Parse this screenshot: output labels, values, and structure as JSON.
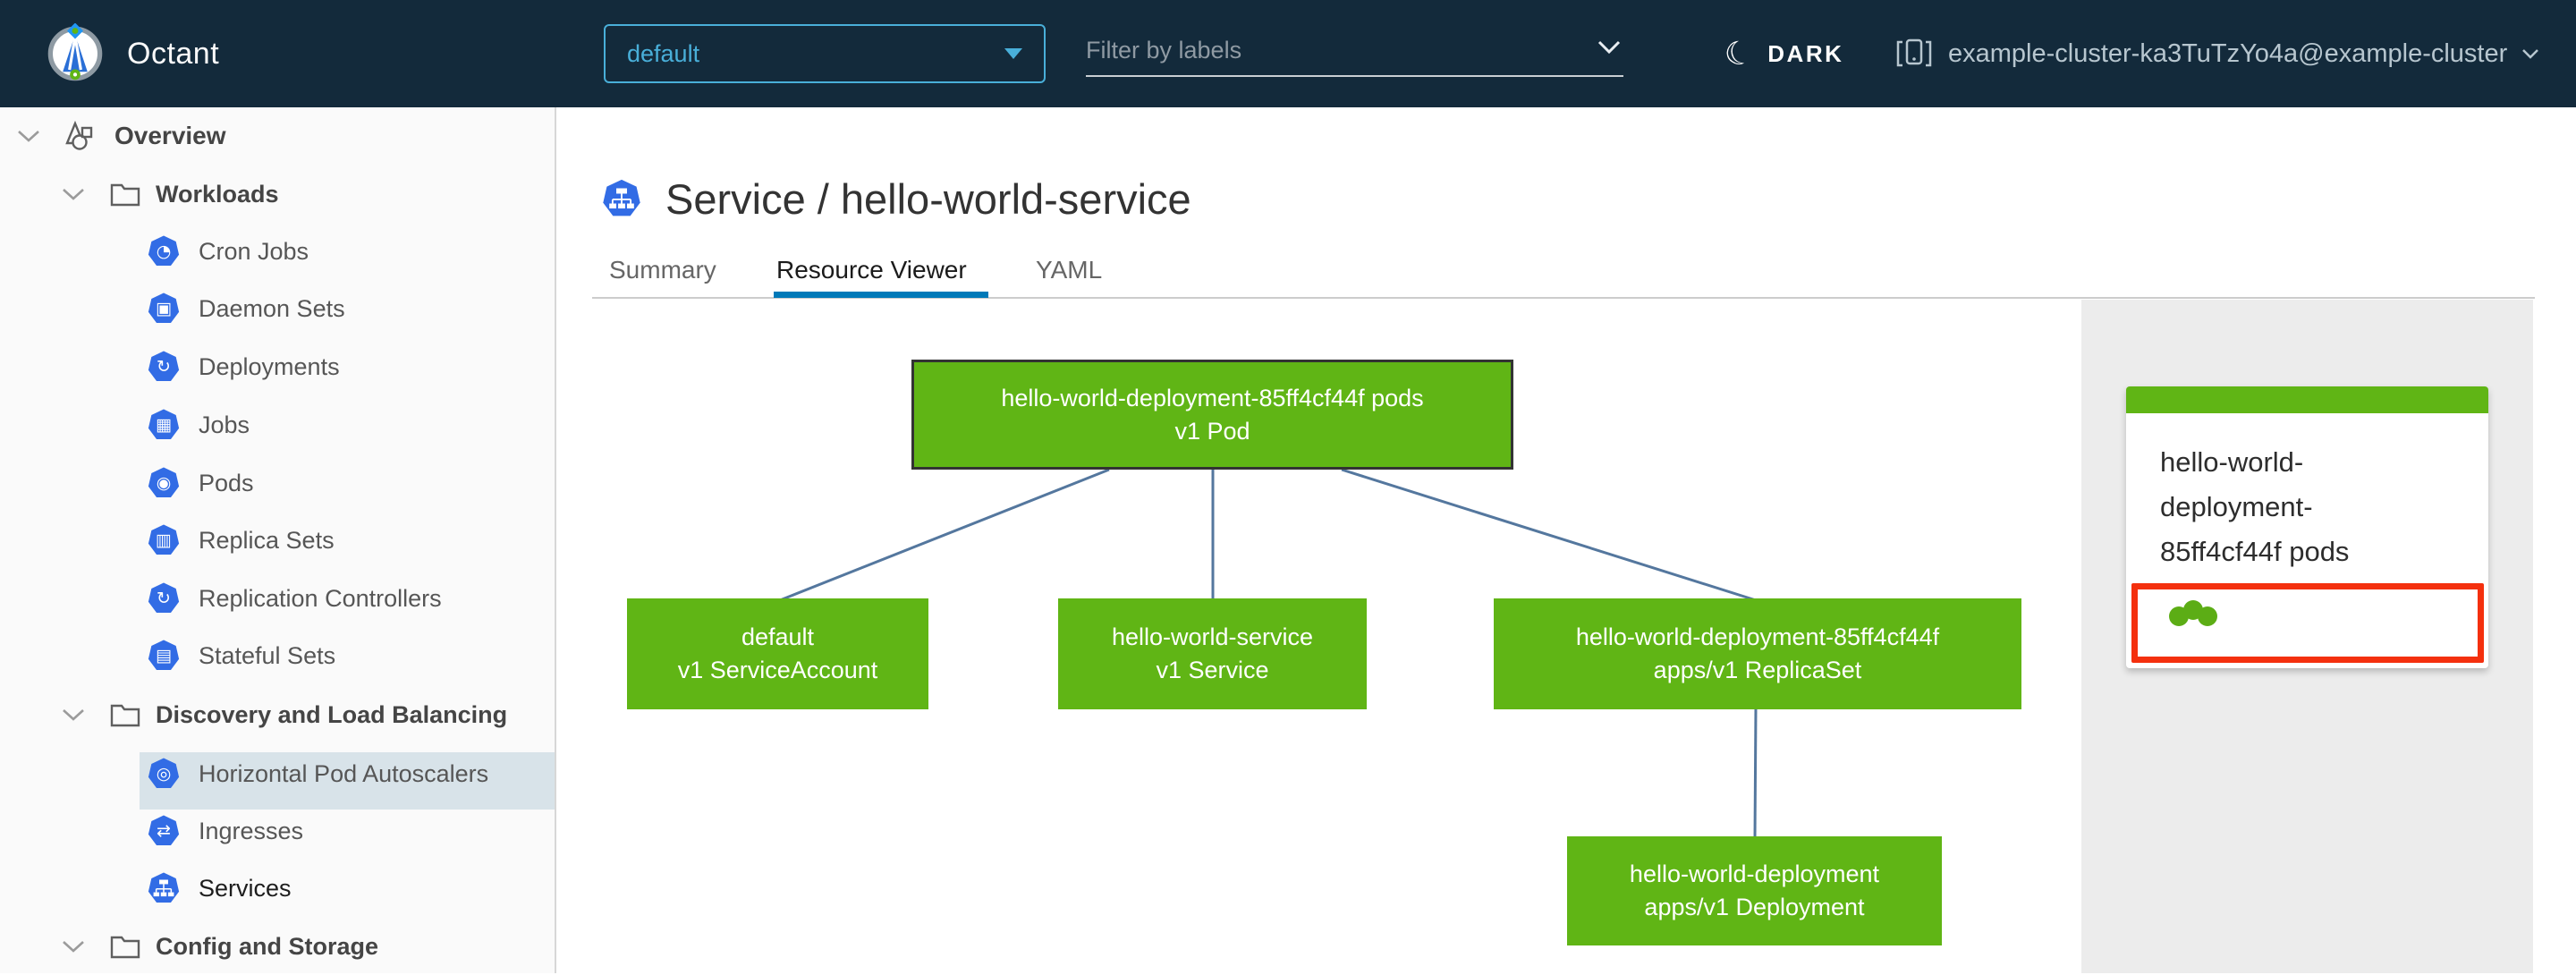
{
  "header": {
    "app_title": "Octant",
    "namespace_dropdown": {
      "value": "default"
    },
    "filter_input": {
      "placeholder": "Filter by labels"
    },
    "theme_toggle_label": "DARK",
    "context_label": "example-cluster-ka3TuTzYo4a@example-cluster"
  },
  "sidebar": {
    "rows": [
      {
        "label": "Overview",
        "icon": "objects-icon"
      },
      {
        "label": "Workloads",
        "icon": "folder-icon"
      },
      {
        "label": "Cron Jobs",
        "icon": "cron-jobs-icon",
        "glyph": "◔"
      },
      {
        "label": "Daemon Sets",
        "icon": "daemon-sets-icon",
        "glyph": "▣"
      },
      {
        "label": "Deployments",
        "icon": "deployments-icon",
        "glyph": "↻"
      },
      {
        "label": "Jobs",
        "icon": "jobs-icon",
        "glyph": "▦"
      },
      {
        "label": "Pods",
        "icon": "pods-icon",
        "glyph": "◉"
      },
      {
        "label": "Replica Sets",
        "icon": "replica-sets-icon",
        "glyph": "▥"
      },
      {
        "label": "Replication Controllers",
        "icon": "replication-controllers-icon",
        "glyph": "↻"
      },
      {
        "label": "Stateful Sets",
        "icon": "stateful-sets-icon",
        "glyph": "▤"
      },
      {
        "label": "Discovery and Load Balancing",
        "icon": "folder-icon"
      },
      {
        "label": "Horizontal Pod Autoscalers",
        "icon": "hpa-icon",
        "glyph": "◎"
      },
      {
        "label": "Ingresses",
        "icon": "ingresses-icon",
        "glyph": "⇄"
      },
      {
        "label": "Services",
        "icon": "services-icon",
        "selected": true
      },
      {
        "label": "Config and Storage",
        "icon": "folder-icon"
      }
    ]
  },
  "content": {
    "title": {
      "text": "Service / hello-world-service",
      "kind_icon": "service-icon"
    },
    "tabs": [
      {
        "label": "Summary",
        "active": false
      },
      {
        "label": "Resource Viewer",
        "active": true
      },
      {
        "label": "YAML",
        "active": false
      }
    ]
  },
  "graph": {
    "nodes": [
      {
        "id": "pod",
        "line1": "hello-world-deployment-85ff4cf44f pods",
        "line2": "v1 Pod",
        "selected": true
      },
      {
        "id": "service-account",
        "line1": "default",
        "line2": "v1 ServiceAccount",
        "selected": false
      },
      {
        "id": "service",
        "line1": "hello-world-service",
        "line2": "v1 Service",
        "selected": false
      },
      {
        "id": "replica-set",
        "line1": "hello-world-deployment-85ff4cf44f",
        "line2": "apps/v1 ReplicaSet",
        "selected": false
      },
      {
        "id": "deployment",
        "line1": "hello-world-deployment",
        "line2": "apps/v1 Deployment",
        "selected": false
      }
    ]
  },
  "side_panel": {
    "card": {
      "title": "hello-world-deployment-85ff4cf44f pods",
      "status_dots": 3
    }
  },
  "colors": {
    "header_navy": "#132a3b",
    "accent_blue": "#49afd9",
    "active_tab_blue": "#0079b8",
    "node_green": "#60b515",
    "node_border": "#333333",
    "edge_blue": "#54779e",
    "k8s_icon_blue": "#326ce5",
    "selected_row_bg": "#d8e3e9",
    "annotation_red": "#f4300e"
  }
}
